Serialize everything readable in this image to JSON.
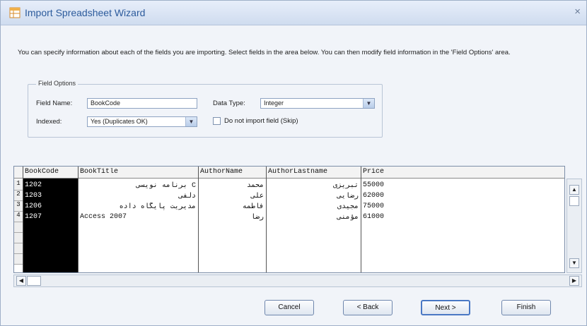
{
  "window": {
    "title": "Import Spreadsheet Wizard",
    "close_glyph": "×"
  },
  "intro": "You can specify information about each of the fields you are importing.  Select fields in the area below. You can then modify field information in the 'Field Options' area.",
  "field_options": {
    "legend": "Field Options",
    "field_name_label": "Field Name:",
    "field_name_value": "BookCode",
    "data_type_label": "Data Type:",
    "data_type_value": "Integer",
    "indexed_label": "Indexed:",
    "indexed_value": "Yes (Duplicates OK)",
    "skip_label": "Do not import field (Skip)",
    "skip_checked": false
  },
  "grid": {
    "columns": [
      "BookCode",
      "BookTitle",
      "AuthorName",
      "AuthorLastname",
      "Price"
    ],
    "row_numbers": [
      "1",
      "2",
      "3",
      "4"
    ],
    "rows": [
      [
        "1202",
        "C برنامه نویسی",
        "محمد",
        "تبریزی",
        "55000"
      ],
      [
        "1203",
        "دلفی",
        "علی",
        "رضایی",
        "62000"
      ],
      [
        "1206",
        "مدیریت پایگاه داده",
        "فاطمه",
        "مجیدی",
        "75000"
      ],
      [
        "1207",
        "Access 2007",
        "رضا",
        "مؤمنی",
        "61000"
      ]
    ]
  },
  "buttons": {
    "cancel": "Cancel",
    "back": "< Back",
    "next": "Next >",
    "finish": "Finish"
  },
  "colors": {
    "title_text": "#2c5b9c",
    "selected_column": "#000000"
  }
}
